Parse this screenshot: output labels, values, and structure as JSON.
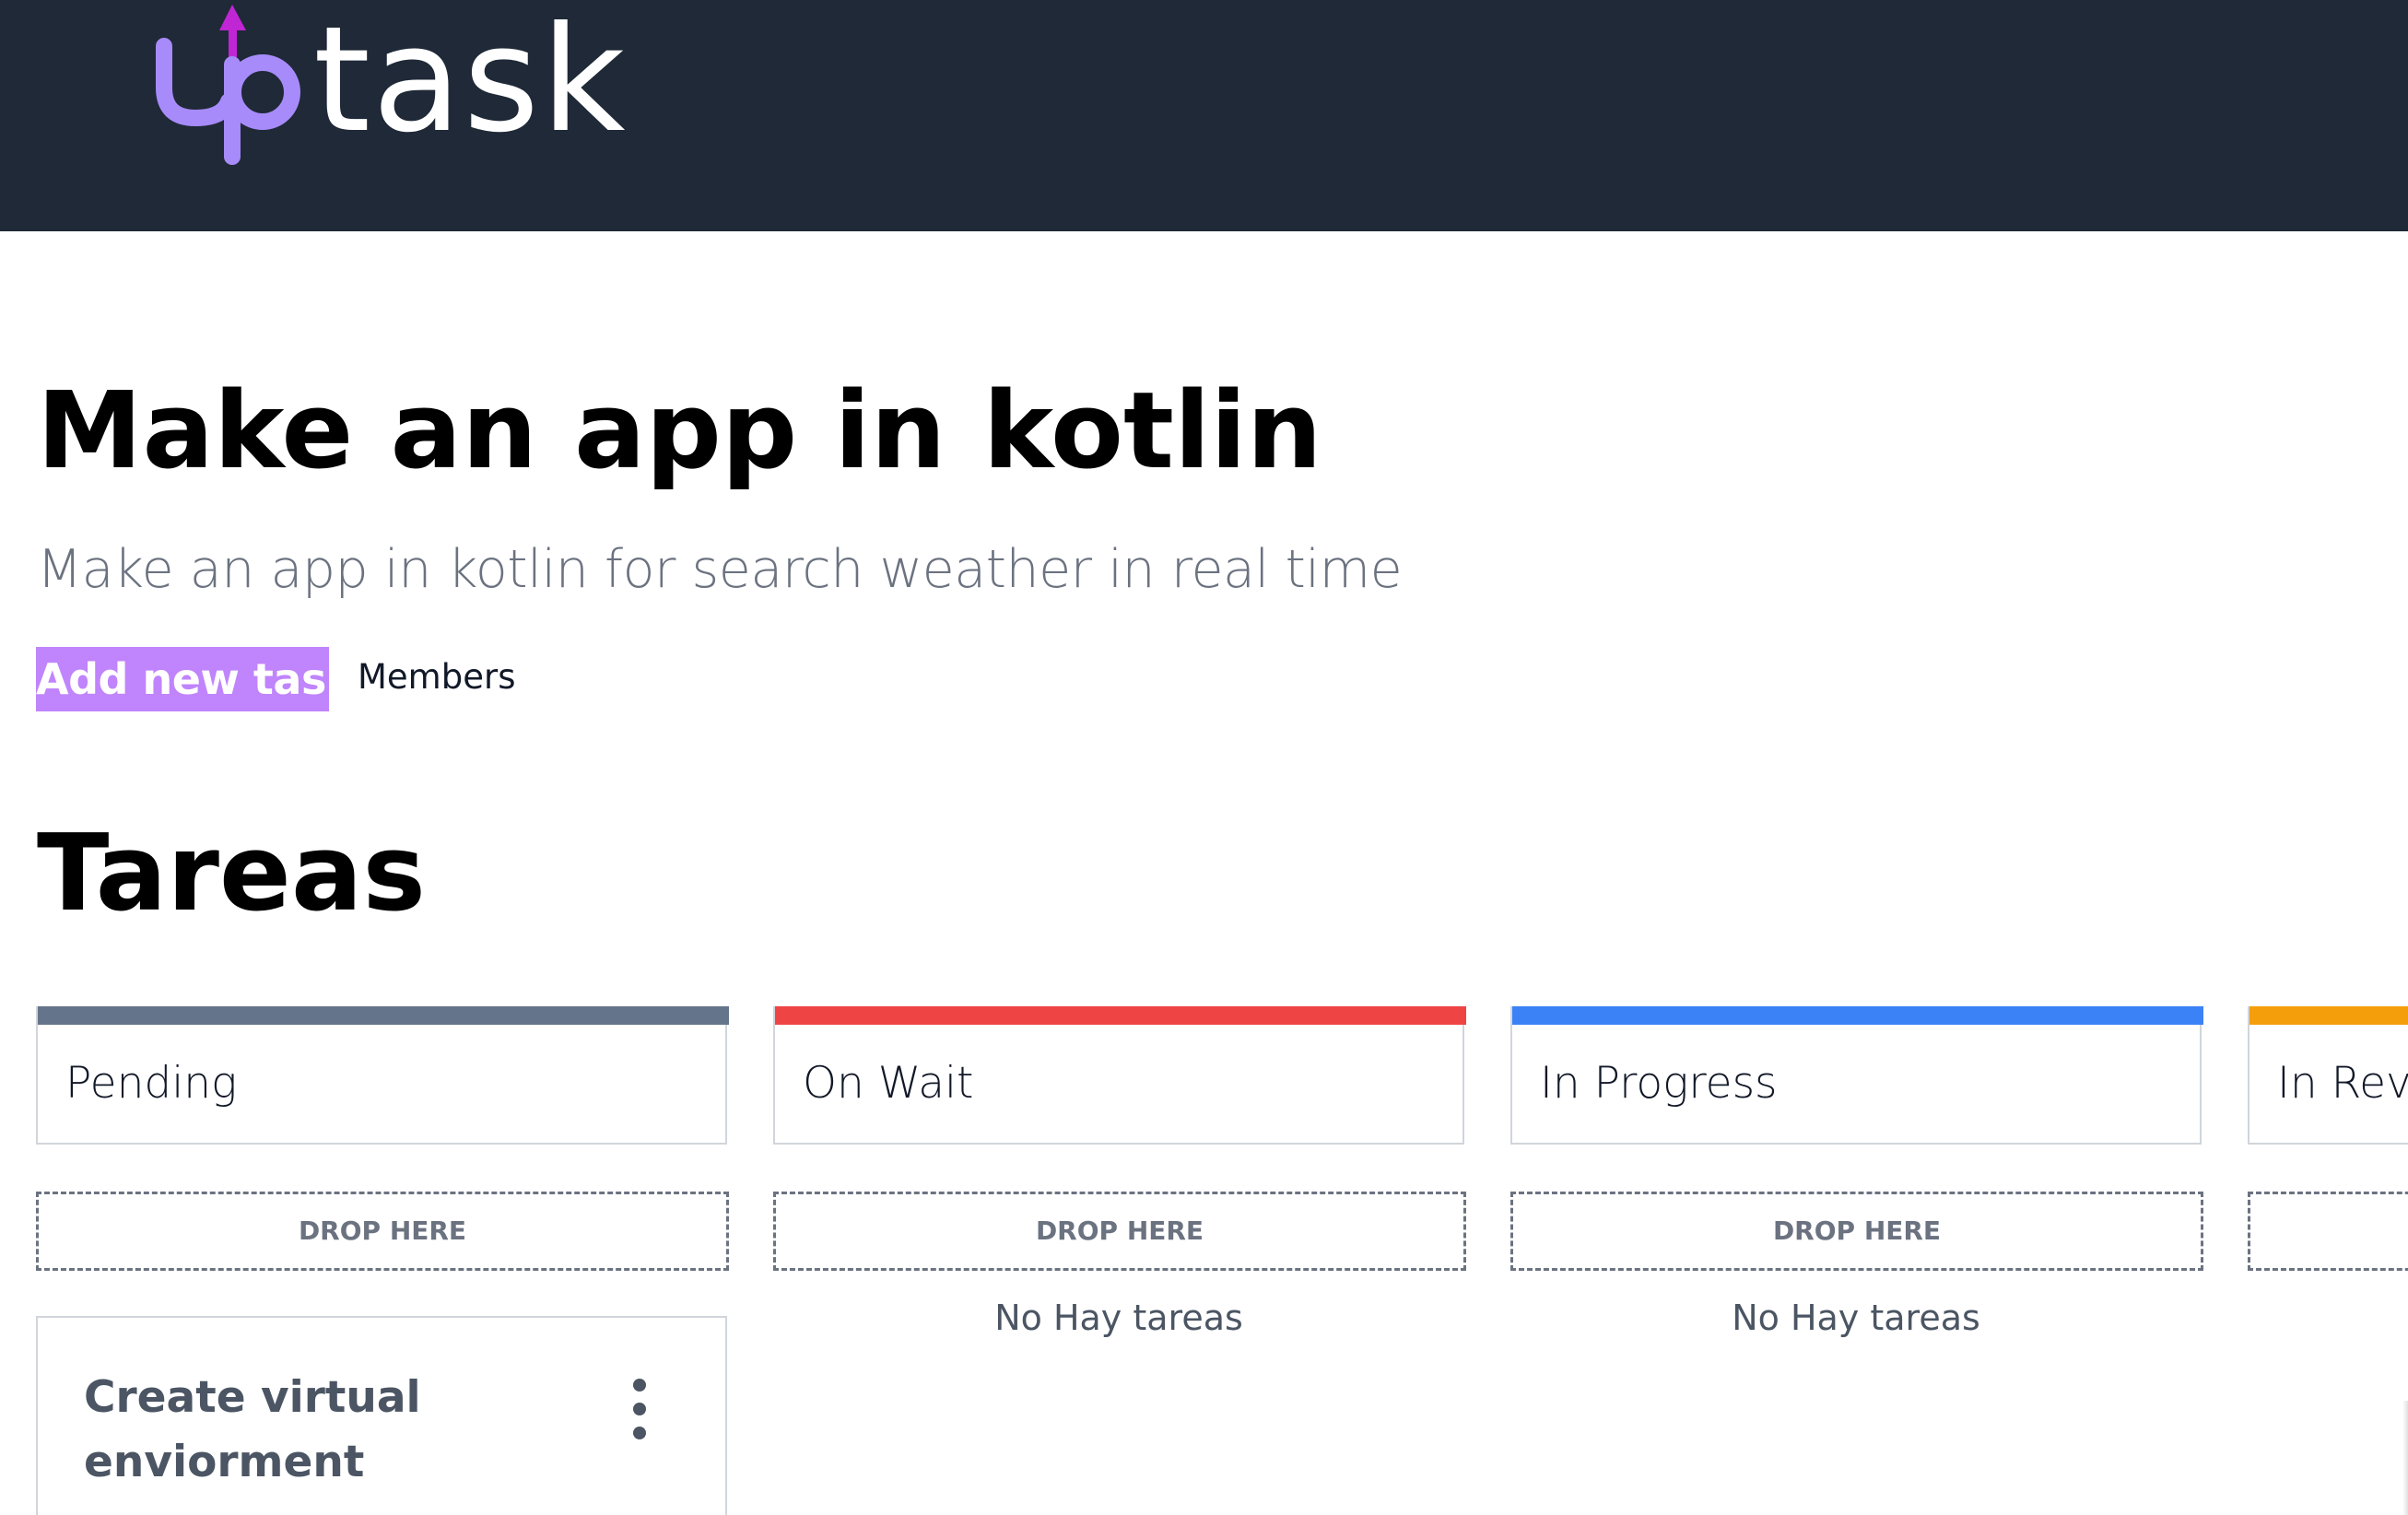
{
  "header": {
    "logo_prefix": "up",
    "logo_text": "task",
    "logo_arrow_color": "#c026d3",
    "logo_up_color": "#a78bfa"
  },
  "project": {
    "title": "Make an app in kotlin",
    "description": "Make an app in kotlin for search weather in real time",
    "add_task_label": "Add new task",
    "members_label": "Members"
  },
  "section_title": "Tareas",
  "columns": [
    {
      "name": "Pending",
      "color": "#64748b",
      "drop_label": "DROP HERE"
    },
    {
      "name": "On Wait",
      "color": "#ef4444",
      "drop_label": "DROP HERE",
      "empty_text": "No Hay tareas"
    },
    {
      "name": "In Progress",
      "color": "#3b82f6",
      "drop_label": "DROP HERE",
      "empty_text": "No Hay tareas"
    },
    {
      "name": "In Revi",
      "color": "#f59e0b",
      "drop_label": ""
    }
  ],
  "tasks": [
    {
      "name": "Create virtual enviorment"
    }
  ],
  "colors": {
    "topbar": "#1f2937",
    "accent": "#c084fc"
  }
}
